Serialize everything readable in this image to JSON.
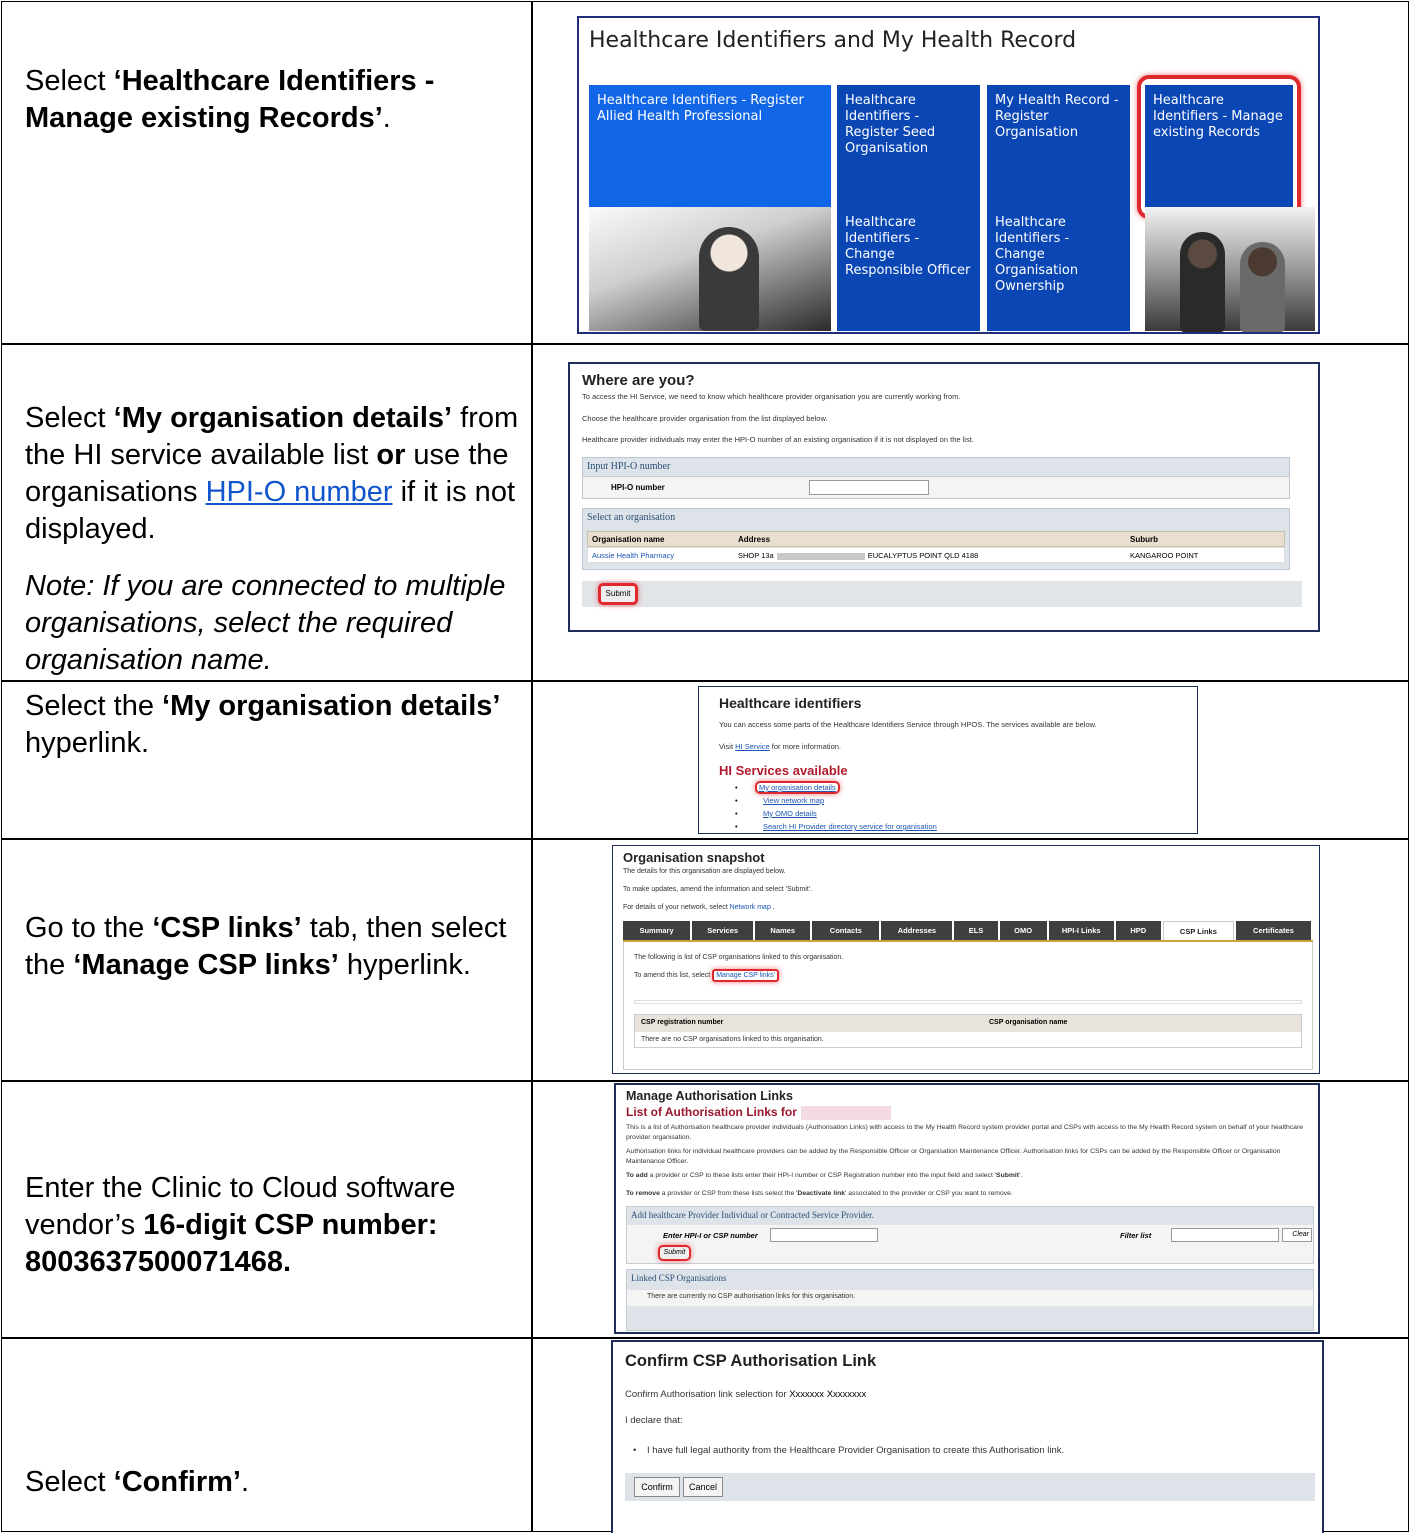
{
  "rows": [
    {
      "id": "r1",
      "instruction": [
        "Select ",
        "‘Healthcare Identifiers - Manage existing Records’",
        "."
      ]
    },
    {
      "id": "r2"
    },
    {
      "id": "r3"
    },
    {
      "id": "r4"
    },
    {
      "id": "r5"
    },
    {
      "id": "r6"
    }
  ],
  "r1": {
    "pre": "Select ",
    "bold": "‘Healthcare Identifiers - Manage existing Records’",
    "post": "."
  },
  "r2": {
    "p1": "Select ",
    "b1": "‘My organisation details’",
    "p2": " from the HI service available list ",
    "b2": "or",
    "p3": " use the organisations ",
    "link": "HPI-O number",
    "p4": " if it is not displayed.",
    "note": "Note: If you are connected to multiple organisations, select the required organisation name."
  },
  "r3": {
    "p1": "Select the ",
    "b1": "‘My organisation details’",
    "p2": " hyperlink."
  },
  "r4": {
    "p1": "Go to the ",
    "b1": "‘CSP links’",
    "p2": " tab, then select the ",
    "b2": "‘Manage CSP links’",
    "p3": " hyperlink."
  },
  "r5": {
    "p1": "Enter the Clinic to Cloud software vendor’s ",
    "b1": "16-digit CSP number: 8003637500071468."
  },
  "r6": {
    "p1": "Select ",
    "b1": "‘Confirm’",
    "p2": "."
  },
  "shot1": {
    "title": "Healthcare Identifiers and My Health Record",
    "tiles": [
      "Healthcare Identifiers - Register Allied Health Professional",
      "Healthcare Identifiers - Register Seed Organisation",
      "My Health Record - Register Organisation",
      "Healthcare Identifiers - Manage existing Records",
      "Healthcare Identifiers - Change Responsible Officer",
      "Healthcare Identifiers - Change Organisation Ownership"
    ]
  },
  "shot2": {
    "title": "Where are you?",
    "l1": "To access the HI Service, we need to know which healthcare provider organisation you are currently working from.",
    "l2": "Choose the healthcare provider organisation from the list displayed below.",
    "l3": "Healthcare provider individuals may enter the HPI-O number of an existing organisation if it is not displayed on the list.",
    "input_section": "Input HPI-O number",
    "input_label": "HPI-O number",
    "select_section": "Select an organisation",
    "col_name": "Organisation name",
    "col_address": "Address",
    "col_suburb": "Suburb",
    "org_name": "Aussie Health Pharmacy",
    "org_address_a": "SHOP 13a",
    "org_address_b": "EUCALYPTUS POINT QLD 4188",
    "org_suburb": "KANGAROO POINT",
    "submit": "Submit"
  },
  "shot3": {
    "title": "Healthcare identifiers",
    "l1": "You can access some parts of the Healthcare Identifiers Service through HPOS. The services available are below.",
    "l2a": "Visit ",
    "l2link": "HI Service",
    "l2b": " for more information.",
    "sub": "HI Services available",
    "items": [
      "My organisation details",
      "View network map",
      "My OMO details",
      "Search HI Provider directory service for organisation"
    ]
  },
  "shot4": {
    "title": "Organisation snapshot",
    "l1": "The details for this organisation are displayed below.",
    "l2": "To make updates, amend the information and select 'Submit'.",
    "l3a": "For details of your network, select ",
    "l3link": "Network map",
    "l3b": " .",
    "tabs": [
      "Summary",
      "Services",
      "Names",
      "Contacts",
      "Addresses",
      "ELS",
      "OMO",
      "HPI-I Links",
      "HPD",
      "CSP Links",
      "Certificates"
    ],
    "p1": "The following is list of CSP organisations linked to this organisation.",
    "p2a": "To amend this list, select ",
    "p2link": "Manage CSP links'",
    "col1": "CSP registration number",
    "col2": "CSP organisation name",
    "empty": "There are no CSP organisations linked to this organisation."
  },
  "shot5": {
    "title": "Manage Authorisation Links",
    "sub": "List of Authorisation Links for",
    "p1": "This is a list of Authorisation healthcare provider individuals (Authorisation Links) with access to the My Health Record system provider portal and CSPs with access to the My Health Record system on behalf of your healthcare provider organisation.",
    "p2": "Authorisation links for individual healthcare providers can be added by the Responsible Officer or Organisation Maintenance Officer. Authorisation links for CSPs can be added by the Responsible Officer or Organisation Maintenance Officer.",
    "p3a": "To add",
    "p3b": " a provider or CSP to these lists enter their HPI-I number or CSP Registration number into the input field and select '",
    "p3c": "Submit",
    "p3d": "'.",
    "p4a": "To remove",
    "p4b": " a provider or CSP from these lists select the '",
    "p4c": "Deactivate link",
    "p4d": "' associated to the provider or CSP you want to remove.",
    "add_section": "Add healthcare Provider Individual or Contracted Service Provider.",
    "enter_label": "Enter HPI-I or CSP number",
    "filter_label": "Filter list",
    "clear": "Clear",
    "submit": "Submit",
    "linked": "Linked CSP Organisations",
    "none": "There are currently no CSP authorisation links for this organisation."
  },
  "shot6": {
    "title": "Confirm CSP Authorisation Link",
    "l1a": "Confirm Authorisation link selection for ",
    "l1b": "Xxxxxxx Xxxxxxxx",
    "l2": "I declare that:",
    "bullet": "I have full legal authority from the Healthcare Provider Organisation to create this Authorisation link.",
    "confirm": "Confirm",
    "cancel": "Cancel"
  }
}
